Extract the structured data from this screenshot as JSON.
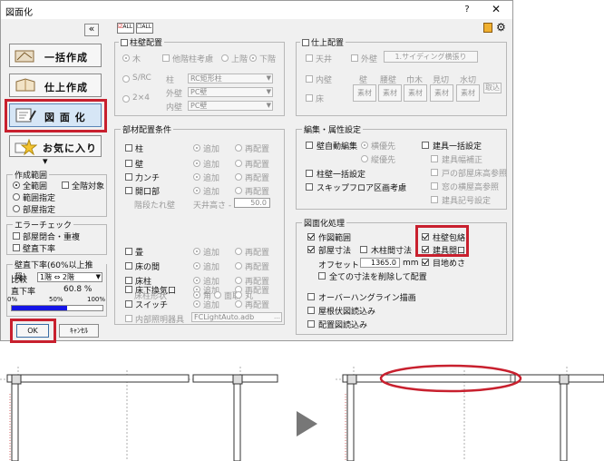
{
  "dialog": {
    "title": "図面化",
    "help": "?",
    "close": "✕",
    "collapse": "«",
    "check_all": "ALL",
    "uncheck_all": "ALL"
  },
  "left": {
    "buttons": [
      {
        "label": "一括作成",
        "icon": "bulk-create-icon"
      },
      {
        "label": "仕上作成",
        "icon": "finish-create-icon"
      },
      {
        "label": "図 面 化",
        "icon": "drawing-icon"
      },
      {
        "label": "お気に入り▾",
        "icon": "favorite-star-icon"
      }
    ],
    "range": {
      "title": "作成範囲",
      "options": [
        "全範囲",
        "範囲指定",
        "部屋指定"
      ],
      "selected": "全範囲",
      "all_target": "全階対象"
    },
    "error": {
      "title": "エラーチェック",
      "items": [
        "部屋閉合・重複",
        "壁直下率"
      ]
    },
    "ratio": {
      "title": "壁直下率(60%以上推奨)",
      "compare_label": "比較",
      "compare_value": "1階 ⇔ 2階",
      "rate_label": "直下率",
      "rate_value": "60.8 %",
      "scale": [
        "0%",
        "50%",
        "100%"
      ],
      "progress": 0.608
    },
    "ok": "OK",
    "cancel": "ｷｬﾝｾﾙ"
  },
  "pillar": {
    "title": "柱壁配置",
    "wood": "木",
    "src": "S/RC",
    "two_by": "2×4",
    "bracing": "他階柱考慮",
    "upper": "上階",
    "lower": "下階",
    "col_label": "柱",
    "col_value": "RC矩形柱",
    "outer_label": "外壁",
    "outer_value": "PC壁",
    "inner_label": "内壁",
    "inner_value": "PC壁"
  },
  "finish": {
    "title": "仕上配置",
    "ceiling": "天井",
    "exterior": "外壁",
    "exterior_btn": "1.サイディング横張り",
    "inner": "内壁",
    "floor": "床",
    "headers": [
      "壁",
      "腰壁",
      "巾木",
      "見切",
      "水切"
    ],
    "material": "素材",
    "take": "取込"
  },
  "members": {
    "title": "部材配置条件",
    "add": "追加",
    "readd": "再配置",
    "rows": [
      "柱",
      "壁",
      "力ンチ",
      "開口部"
    ],
    "wall_height_label": "階段たれ壁",
    "ceiling_height_label": "天井高さ -",
    "ceiling_height_value": "50.0",
    "rows2": [
      "畳",
      "床の間",
      "床柱"
    ],
    "pillar_shape": "床柱形状",
    "shapes": [
      "角",
      "面取",
      "丸"
    ],
    "rows3": [
      "床下換気口",
      "スイッチ",
      "内部照明器具"
    ],
    "lighting_value": "FCLightAuto.adb"
  },
  "edit": {
    "title": "編集・属性設定",
    "auto_wall": "壁自動編集",
    "priority_h": "横優先",
    "priority_v": "縦優先",
    "pillar_wall_bulk": "柱壁一括設定",
    "skip_floor": "スキップフロア区画考慮",
    "fixture_bulk": "建具一括設定",
    "fixture_items": [
      "建具幅補正",
      "戸の部屋床高参照",
      "窓の横屋高参照",
      "建具記号設定"
    ]
  },
  "draw": {
    "title": "図面化処理",
    "drawing_range": "作図範囲",
    "room_dims": "部屋寸法",
    "wood_dims": "木柱間寸法",
    "pillar_wall": "柱壁包絡",
    "fixture_open": "建具開口",
    "eye": "目地めさ",
    "offset_label": "オフセット",
    "offset_value": "1365.0",
    "offset_unit": "mm",
    "delete_all": "全ての寸法を削除して配置",
    "overhang": "オーバーハングライン描画",
    "roof": "屋根伏図読込み",
    "layout": "配置図読込み"
  },
  "colors": {
    "accent": "#c8202e",
    "progress": "#1414e6",
    "selected_btn": "#d6e6f6"
  }
}
